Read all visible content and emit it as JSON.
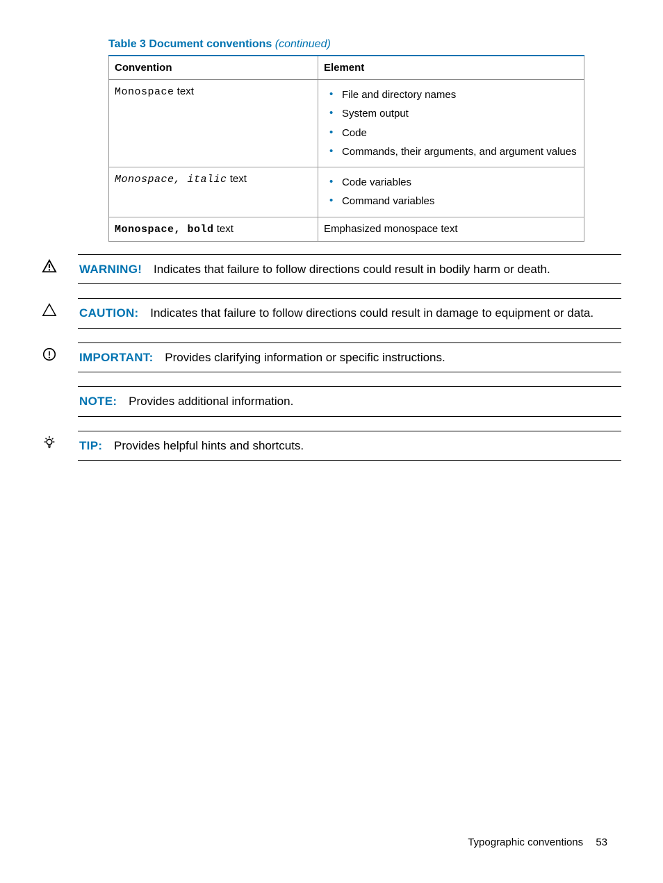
{
  "table": {
    "caption_bold": "Table 3 Document conventions",
    "caption_italic": "(continued)",
    "headers": {
      "col1": "Convention",
      "col2": "Element"
    },
    "rows": [
      {
        "conv_mono": "Monospace",
        "conv_plain": " text",
        "conv_style": "plain",
        "bullets": [
          "File and directory names",
          "System output",
          "Code",
          "Commands, their arguments, and argument values"
        ]
      },
      {
        "conv_mono": "Monospace, italic",
        "conv_plain": " text",
        "conv_style": "italic",
        "bullets": [
          "Code variables",
          "Command variables"
        ]
      },
      {
        "conv_mono": "Monospace, bold",
        "conv_plain": " text",
        "conv_style": "bold",
        "plain_text": "Emphasized monospace text"
      }
    ]
  },
  "callouts": [
    {
      "icon": "warning-triangle-filled",
      "label": "WARNING!",
      "text": "Indicates that failure to follow directions could result in bodily harm or death."
    },
    {
      "icon": "warning-triangle-outline",
      "label": "CAUTION:",
      "text": "Indicates that failure to follow directions could result in damage to equipment or data."
    },
    {
      "icon": "circle-exclaim",
      "label": "IMPORTANT:",
      "text": "Provides clarifying information or specific instructions."
    },
    {
      "icon": "",
      "label": "NOTE:",
      "text": "Provides additional information."
    },
    {
      "icon": "tip-bulb",
      "label": "TIP:",
      "text": "Provides helpful hints and shortcuts."
    }
  ],
  "footer": {
    "section": "Typographic conventions",
    "page": "53"
  }
}
